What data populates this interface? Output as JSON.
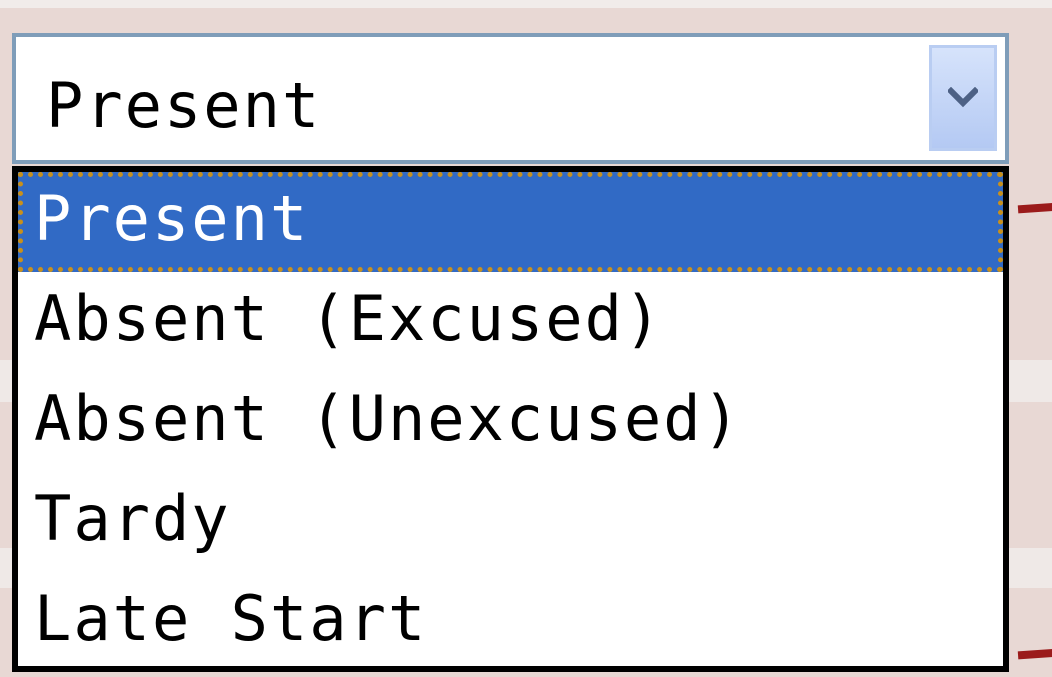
{
  "select": {
    "current_value": "Present",
    "arrow_icon": "chevron-down-icon",
    "options": [
      {
        "label": "Present",
        "selected": true
      },
      {
        "label": "Absent (Excused)",
        "selected": false
      },
      {
        "label": "Absent (Unexcused)",
        "selected": false
      },
      {
        "label": "Tardy",
        "selected": false
      },
      {
        "label": "Late Start",
        "selected": false
      }
    ]
  },
  "colors": {
    "selected_bg": "#316ac5",
    "selected_text": "#ffffff",
    "border": "#7f9db9",
    "accent_mark": "#9b1b1b"
  }
}
